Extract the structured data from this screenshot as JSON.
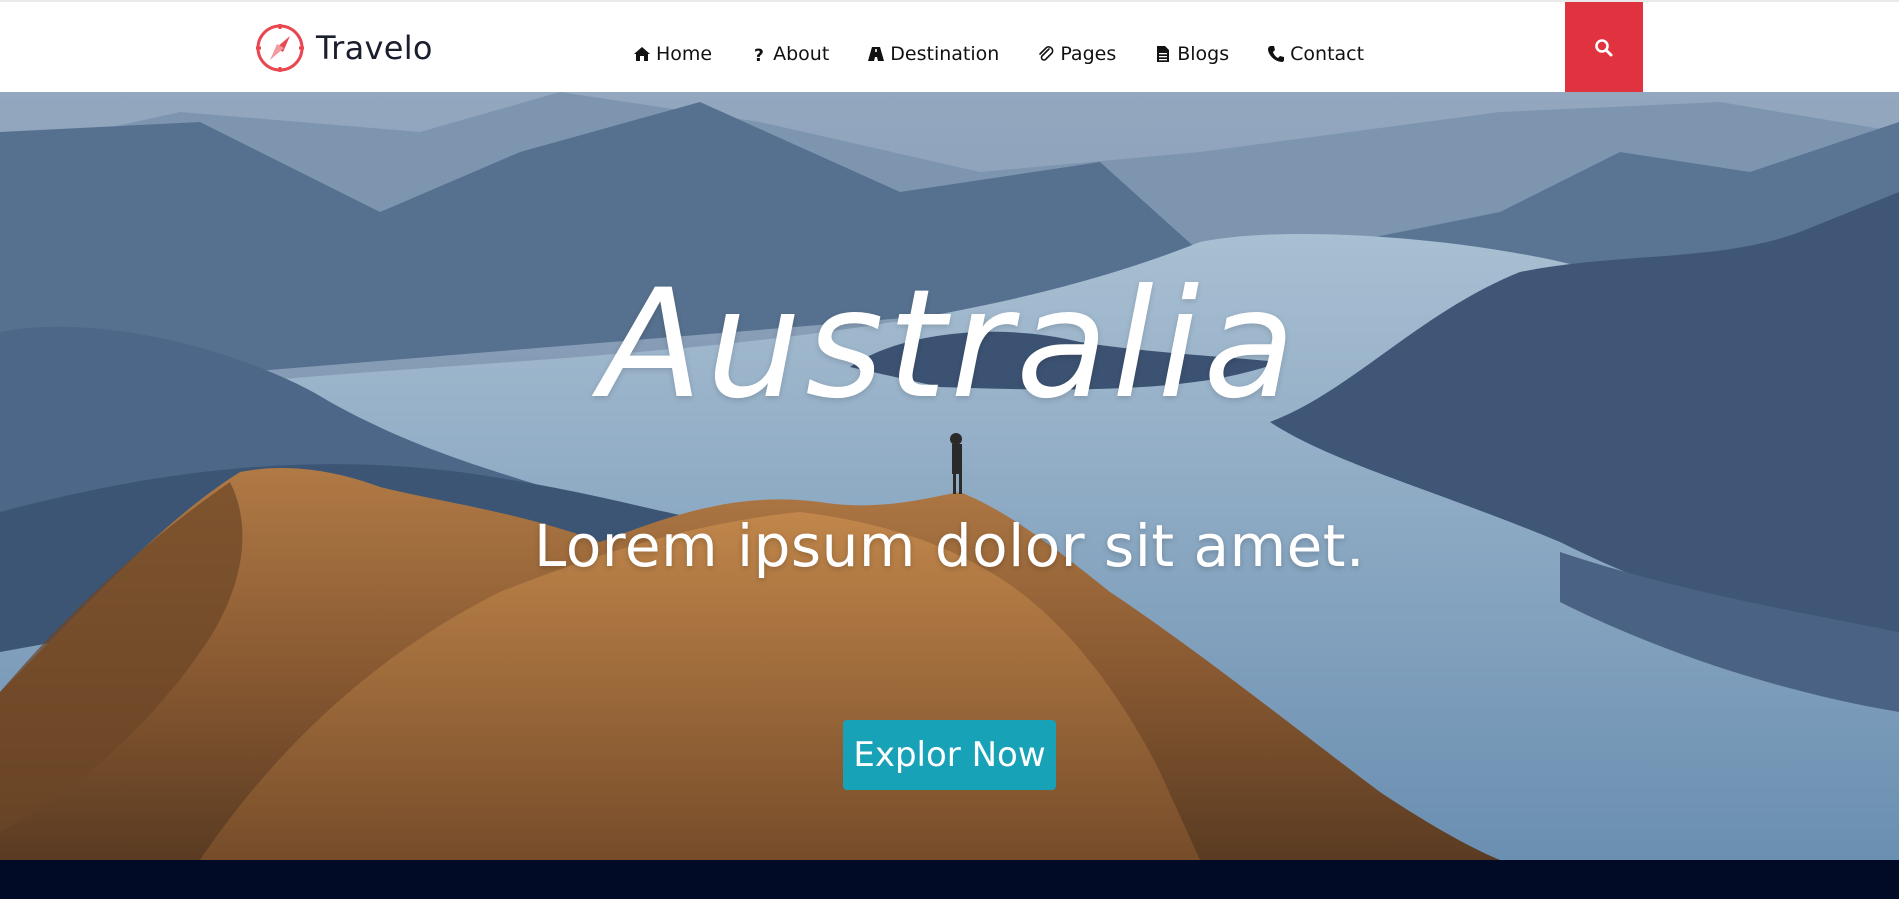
{
  "header": {
    "brand": "Travelo",
    "logo_icon": "compass-icon",
    "nav": [
      {
        "label": "Home",
        "icon": "home-icon"
      },
      {
        "label": "About",
        "icon": "question-icon"
      },
      {
        "label": "Destination",
        "icon": "road-icon"
      },
      {
        "label": "Pages",
        "icon": "paperclip-icon"
      },
      {
        "label": "Blogs",
        "icon": "document-icon"
      },
      {
        "label": "Contact",
        "icon": "phone-icon"
      }
    ],
    "search_icon": "search-icon"
  },
  "hero": {
    "title": "Australia",
    "subtitle": "Lorem ipsum dolor sit amet.",
    "cta_label": "Explor Now"
  },
  "colors": {
    "accent_red": "#e0323f",
    "cta_teal": "#17a2b8",
    "footer_navy": "#020b26"
  }
}
